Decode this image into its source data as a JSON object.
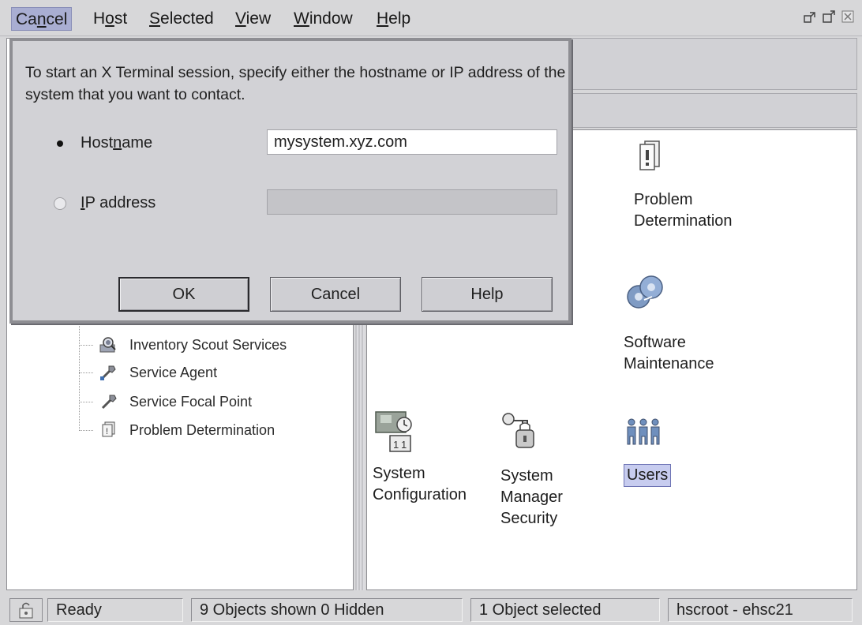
{
  "menu": {
    "items": [
      {
        "label": "Cancel",
        "mnemonic": "n"
      },
      {
        "label": "Host",
        "mnemonic": "o"
      },
      {
        "label": "Selected",
        "mnemonic": "S"
      },
      {
        "label": "View",
        "mnemonic": "V"
      },
      {
        "label": "Window",
        "mnemonic": "W"
      },
      {
        "label": "Help",
        "mnemonic": "H"
      }
    ]
  },
  "window_controls": [
    "restore-icon",
    "maximize-icon",
    "close-icon"
  ],
  "dialog": {
    "message": "To start an X Terminal session, specify either the hostname or IP address of the system that you want to contact.",
    "hostname_option": {
      "label": "Hostname",
      "selected": true
    },
    "ip_option": {
      "label": "IP address",
      "selected": false
    },
    "hostname_value": "mysystem.xyz.com",
    "ip_value": "",
    "buttons": {
      "ok": "OK",
      "cancel": "Cancel",
      "help": "Help"
    }
  },
  "tree": {
    "items": [
      {
        "label": "Inventory Scout Services",
        "icon": "inventory-scout-icon"
      },
      {
        "label": "Service Agent",
        "icon": "service-agent-icon"
      },
      {
        "label": "Service Focal Point",
        "icon": "service-focal-point-icon"
      },
      {
        "label": "Problem Determination",
        "icon": "problem-determination-icon"
      }
    ]
  },
  "workarea": {
    "icons": [
      {
        "label": "Problem\nDetermination",
        "icon": "problem-determination-icon"
      },
      {
        "label": "Software\nMaintenance",
        "icon": "software-maintenance-icon"
      },
      {
        "label": "System\nConfiguration",
        "icon": "system-configuration-icon"
      },
      {
        "label": "System\nManager\nSecurity",
        "icon": "security-keys-icon"
      },
      {
        "label": "Users",
        "icon": "users-icon",
        "selected": true
      }
    ]
  },
  "status": {
    "state": "Ready",
    "objects": "9 Objects shown 0 Hidden",
    "selection": "1 Object selected",
    "user": "hscroot - ehsc21"
  },
  "colors": {
    "menu_active": "#a9aed2",
    "selection_highlight": "#c7ccef",
    "chrome": "#d7d7d9"
  }
}
